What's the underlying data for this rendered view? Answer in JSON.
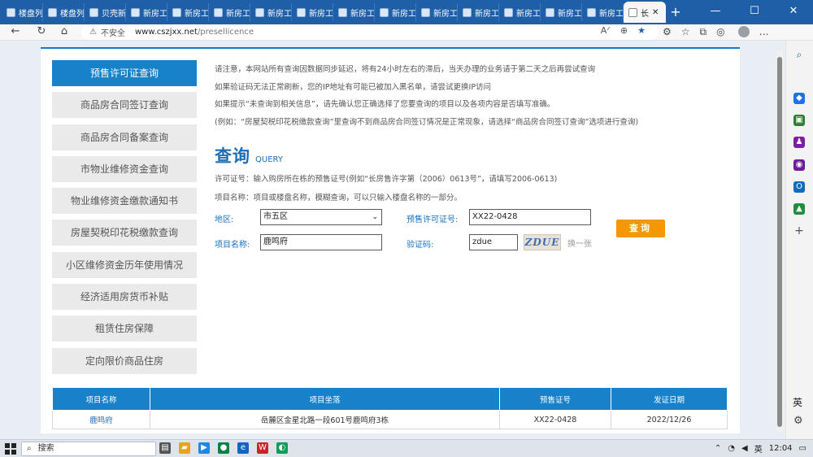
{
  "browser": {
    "tabs": [
      {
        "label": "楼盘列"
      },
      {
        "label": "楼盘列"
      },
      {
        "label": "贝壳新"
      },
      {
        "label": "新房工"
      },
      {
        "label": "新房工"
      },
      {
        "label": "新房工"
      },
      {
        "label": "新房工"
      },
      {
        "label": "新房工"
      },
      {
        "label": "新房工"
      },
      {
        "label": "新房工"
      },
      {
        "label": "新房工"
      },
      {
        "label": "新房工"
      },
      {
        "label": "新房工"
      },
      {
        "label": "新房工"
      },
      {
        "label": "新房工"
      },
      {
        "label": "长"
      }
    ],
    "security_label": "不安全",
    "url_host": "www.cszjxx.net",
    "url_path": "/presellicence"
  },
  "sidebar": {
    "items": [
      {
        "label": "预售许可证查询",
        "active": true
      },
      {
        "label": "商品房合同签订查询"
      },
      {
        "label": "商品房合同备案查询"
      },
      {
        "label": "市物业维修资金查询"
      },
      {
        "label": "物业维修资金缴款通知书"
      },
      {
        "label": "房屋契税印花税缴款查询"
      },
      {
        "label": "小区维修资金历年使用情况"
      },
      {
        "label": "经济适用房货币补贴"
      },
      {
        "label": "租赁住房保障"
      },
      {
        "label": "定向限价商品住房"
      }
    ]
  },
  "notice": {
    "lines": [
      "请注意，本网站所有查询因数据同步延迟，将有24小时左右的滞后，当天办理的业务请于第二天之后再尝试查询",
      "如果验证码无法正常刷新，您的IP地址有可能已被加入黑名单，请尝试更换IP访问",
      "如果提示“未查询到相关信息”，请先确认您正确选择了您要查询的项目以及各项内容是否填写准确。",
      "(例如：“房屋契税印花税缴款查询”里查询不到商品房合同签订情况是正常现象，请选择“商品房合同签订查询”选项进行查询)"
    ]
  },
  "query": {
    "title": "查询",
    "title_en": "QUERY",
    "hint_license": "许可证号：输入购房所在栋的预售证号(例如“长房售许字第（2006）0613号”，请填写2006-0613)",
    "hint_project": "项目名称：项目或楼盘名称，模糊查询，可以只输入楼盘名称的一部分。",
    "region_label": "地区:",
    "region_value": "市五区",
    "license_label": "预售许可证号:",
    "license_value": "XX22-0428",
    "project_label": "项目名称:",
    "project_value": "鹿鸣府",
    "captcha_label": "验证码:",
    "captcha_value": "zdue",
    "captcha_image_text": "ZDUE",
    "refresh_label": "换一张",
    "submit_label": "查询"
  },
  "results": {
    "headers": [
      "项目名称",
      "项目坐落",
      "预售证号",
      "发证日期"
    ],
    "rows": [
      [
        "鹿鸣府",
        "岳麓区金星北路一段601号鹿鸣府3栋",
        "XX22-0428",
        "2022/12/26"
      ]
    ]
  },
  "edge_sidebar": {
    "lang": "英"
  },
  "taskbar": {
    "search_label": "搜索",
    "ime": "英",
    "time": "12:04"
  }
}
